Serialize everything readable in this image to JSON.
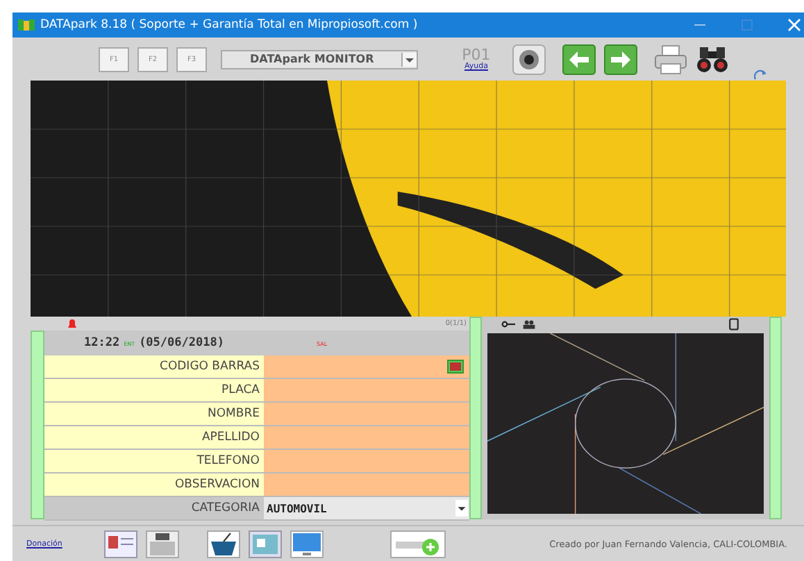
{
  "window": {
    "title": "DATApark 8.18  ( Soporte + Garantía Total en Mipropiosoft.com )"
  },
  "toolbar": {
    "function_keys": [
      "F1",
      "F2",
      "F3"
    ],
    "monitor_select": "DATApark MONITOR",
    "station": "P01",
    "help_link": "Ayuda"
  },
  "status": {
    "counter": "0(1/1)",
    "time": "12:22",
    "entry_tag": "ENT",
    "date": "(05/06/2018)",
    "exit_tag": "SAL"
  },
  "form": {
    "fields": [
      {
        "label": "CODIGO BARRAS",
        "kind": "barcode"
      },
      {
        "label": "PLACA",
        "kind": "text"
      },
      {
        "label": "NOMBRE",
        "kind": "text"
      },
      {
        "label": "APELLIDO",
        "kind": "text"
      },
      {
        "label": "TELEFONO",
        "kind": "text"
      },
      {
        "label": "OBSERVACION",
        "kind": "text"
      }
    ],
    "category": {
      "label": "CATEGORIA",
      "value": "AUTOMOVIL"
    }
  },
  "footer": {
    "donation_link": "Donación",
    "credit": "Creado por Juan Fernando Valencia, CALI-COLOMBIA."
  }
}
